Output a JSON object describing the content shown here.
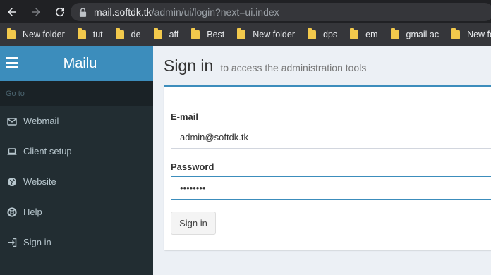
{
  "browser": {
    "url_host": "mail.softdk.tk",
    "url_path": "/admin/ui/login?next=ui.index",
    "bookmarks": [
      "New folder",
      "tut",
      "de",
      "aff",
      "Best",
      "New folder",
      "dps",
      "em",
      "gmail ac",
      "New folder"
    ]
  },
  "sidebar": {
    "brand": "Mailu",
    "goto_label": "Go to",
    "items": [
      {
        "label": "Webmail",
        "icon": "envelope-icon"
      },
      {
        "label": "Client setup",
        "icon": "laptop-icon"
      },
      {
        "label": "Website",
        "icon": "globe-icon"
      },
      {
        "label": "Help",
        "icon": "life-ring-icon"
      },
      {
        "label": "Sign in",
        "icon": "sign-in-icon"
      }
    ]
  },
  "header": {
    "title": "Sign in",
    "subtitle": "to access the administration tools"
  },
  "form": {
    "email_label": "E-mail",
    "email_value": "admin@softdk.tk",
    "password_label": "Password",
    "password_value": "••••••••",
    "submit_label": "Sign in"
  },
  "colors": {
    "accent": "#3c8dbc",
    "sidebar_bg": "#222d32",
    "content_bg": "#ecf0f5"
  }
}
